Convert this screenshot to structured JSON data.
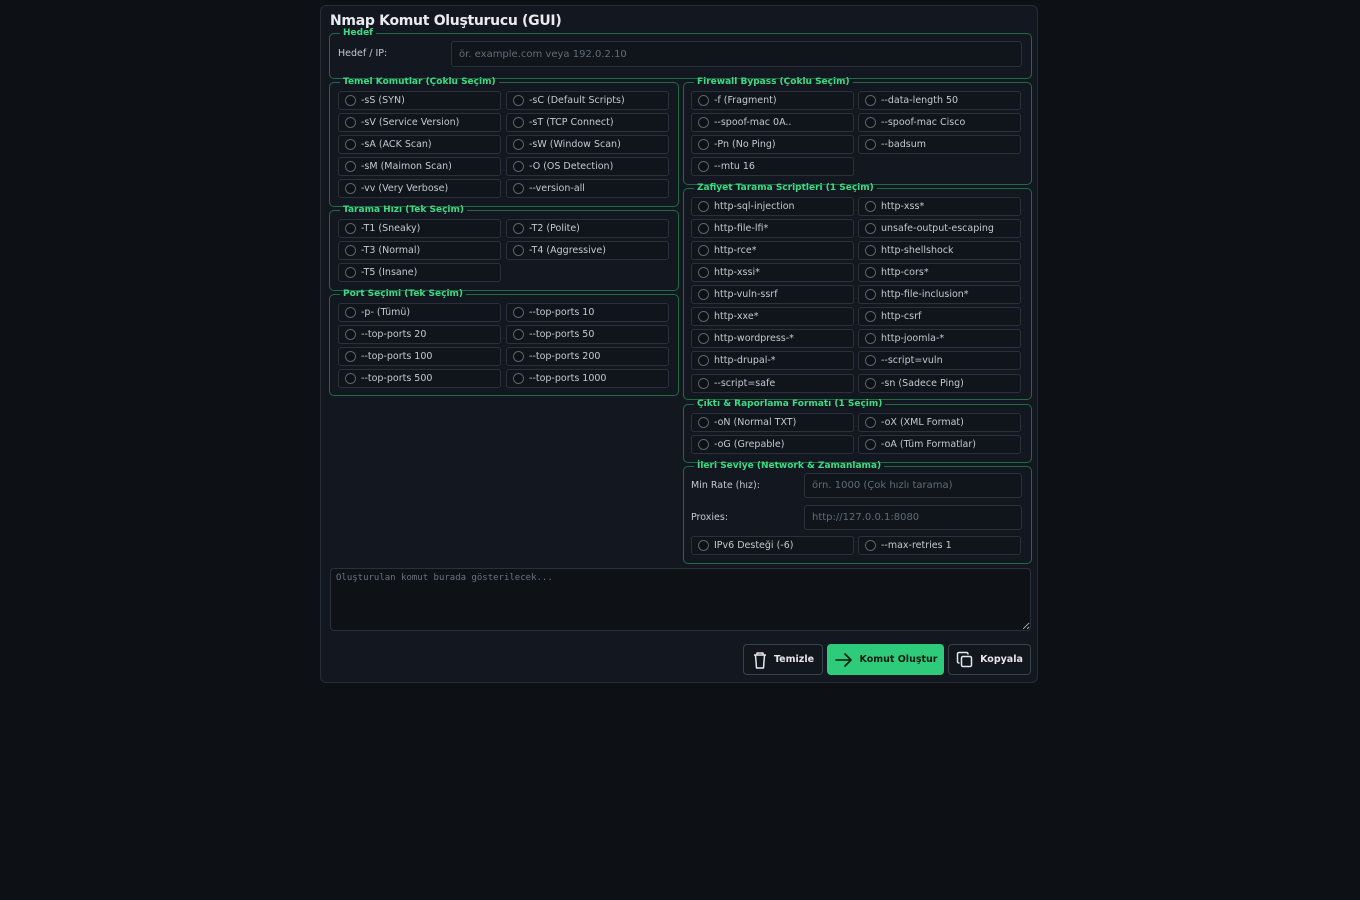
{
  "app": {
    "title": "Nmap Komut Oluşturucu (GUI)"
  },
  "target": {
    "legend": "Hedef",
    "label": "Hedef / IP:",
    "placeholder": "ör. example.com veya 192.0.2.10",
    "value": ""
  },
  "basic": {
    "legend": "Temel Komutlar (Çoklu Seçim)",
    "options": [
      "-sS (SYN)",
      "-sC (Default Scripts)",
      "-sV (Service Version)",
      "-sT (TCP Connect)",
      "-sA (ACK Scan)",
      "-sW (Window Scan)",
      "-sM (Maimon Scan)",
      "-O (OS Detection)",
      "-vv (Very Verbose)",
      "--version-all"
    ]
  },
  "timing": {
    "legend": "Tarama Hızı (Tek Seçim)",
    "options": [
      "-T1 (Sneaky)",
      "-T2 (Polite)",
      "-T3 (Normal)",
      "-T4 (Aggressive)",
      "-T5 (Insane)"
    ]
  },
  "ports": {
    "legend": "Port Seçimi (Tek Seçim)",
    "options": [
      "-p- (Tümü)",
      "--top-ports 10",
      "--top-ports 20",
      "--top-ports 50",
      "--top-ports 100",
      "--top-ports 200",
      "--top-ports 500",
      "--top-ports 1000"
    ]
  },
  "firewall": {
    "legend": "Firewall Bypass (Çoklu Seçim)",
    "options": [
      "-f (Fragment)",
      "--data-length 50",
      "--spoof-mac 0A..",
      "--spoof-mac Cisco",
      "-Pn (No Ping)",
      "--badsum",
      "--mtu 16"
    ]
  },
  "vuln": {
    "legend": "Zafiyet Tarama Scriptleri (1 Seçim)",
    "options": [
      "http-sql-injection",
      "http-xss*",
      "http-file-lfi*",
      "unsafe-output-escaping",
      "http-rce*",
      "http-shellshock",
      "http-xssi*",
      "http-cors*",
      "http-vuln-ssrf",
      "http-file-inclusion*",
      "http-xxe*",
      "http-csrf",
      "http-wordpress-*",
      "http-joomla-*",
      "http-drupal-*",
      "--script=vuln",
      "--script=safe",
      "-sn (Sadece Ping)"
    ]
  },
  "output": {
    "legend": "Çıktı & Raporlama Formatı (1 Seçim)",
    "options": [
      "-oN (Normal TXT)",
      "-oX (XML Format)",
      "-oG (Grepable)",
      "-oA (Tüm Formatlar)"
    ]
  },
  "advanced": {
    "legend": "İleri Seviye (Network & Zamanlama)",
    "min_rate_label": "Min Rate (hız):",
    "min_rate_placeholder": "örn. 1000 (Çok hızlı tarama)",
    "proxies_label": "Proxies:",
    "proxies_placeholder": "http://127.0.0.1:8080",
    "options": [
      "IPv6 Desteği (-6)",
      "--max-retries 1"
    ]
  },
  "result": {
    "placeholder": "Oluşturulan komut burada gösterilecek..."
  },
  "buttons": {
    "clear": "Temizle",
    "build": "Komut Oluştur",
    "copy": "Kopyala"
  },
  "colors": {
    "accent": "#2ecc7a",
    "legend": "#3ddc84",
    "background": "#0d1014",
    "panel": "#131820"
  }
}
